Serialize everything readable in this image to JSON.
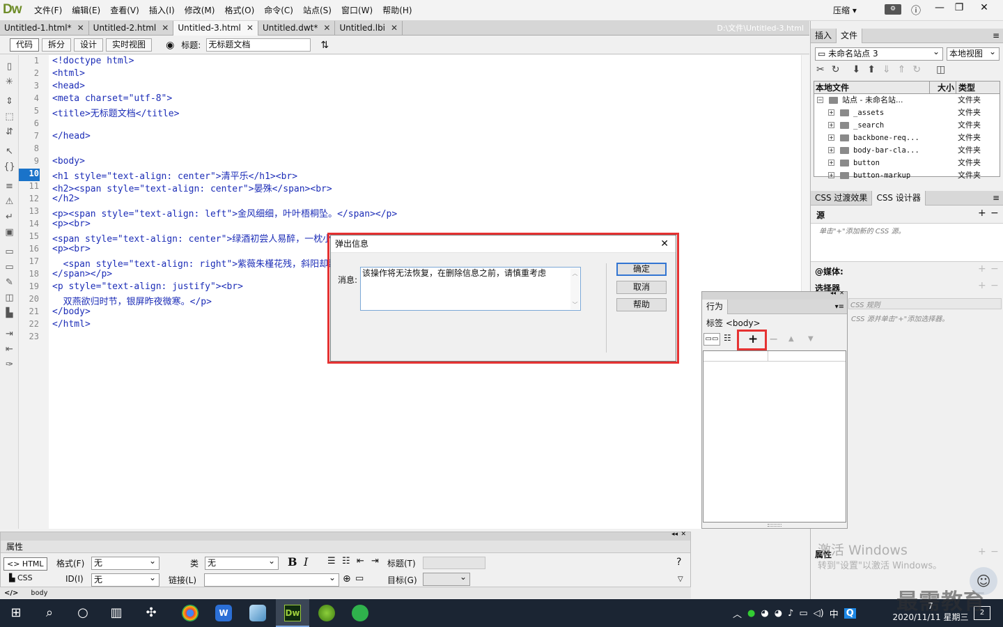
{
  "app": {
    "logo": "Dw",
    "menus": [
      "文件(F)",
      "编辑(E)",
      "查看(V)",
      "插入(I)",
      "修改(M)",
      "格式(O)",
      "命令(C)",
      "站点(S)",
      "窗口(W)",
      "帮助(H)"
    ],
    "compress": "压缩 ▾"
  },
  "tabs": [
    {
      "label": "Untitled-1.html*"
    },
    {
      "label": "Untitled-2.html"
    },
    {
      "label": "Untitled-3.html"
    },
    {
      "label": "Untitled.dwt*"
    },
    {
      "label": "Untitled.lbi"
    }
  ],
  "filepath": "D:\\文件\\Untitled-3.html",
  "doc_toolbar": {
    "views": [
      "代码",
      "拆分",
      "设计",
      "实时视图"
    ],
    "title_label": "标题:",
    "title_value": "无标题文档"
  },
  "code_lines": [
    "<!doctype html>",
    "<html>",
    "<head>",
    "<meta charset=\"utf-8\">",
    "<title>无标题文档</title>",
    "",
    "</head>",
    "",
    "<body>",
    "<h1 style=\"text-align: center\">清平乐</h1><br>",
    "<h2><span style=\"text-align: center\">晏殊</span><br>",
    "</h2>",
    "<p><span style=\"text-align: left\">金风细细，叶叶梧桐坠。</span></p>",
    "<p><br>",
    "<span style=\"text-align: center\">绿酒初尝人易醉，一枕小窗浓睡。",
    "<p><br>",
    "  <span style=\"text-align: right\">紫薇朱槿花残，斜阳却照阑干。",
    "</span></p>",
    "<p style=\"text-align: justify\"><br>",
    "  双燕欲归时节，银屏昨夜微寒。</p>",
    "</body>",
    "</html>",
    ""
  ],
  "line_numbers": [
    "1",
    "2",
    "3",
    "4",
    "5",
    "6",
    "7",
    "8",
    "9",
    "10",
    "11",
    "12",
    "13",
    "14",
    "15",
    "16",
    "17",
    "18",
    "19",
    "20",
    "21",
    "22",
    "23"
  ],
  "dialog": {
    "title": "弹出信息",
    "close": "✕",
    "message_label": "消息:",
    "message": "该操作将无法恢复，在删除信息之前，请慎重考虑",
    "buttons": {
      "ok": "确定",
      "cancel": "取消",
      "help": "帮助"
    }
  },
  "behaviors": {
    "title": "行为",
    "tag_label": "标签 <body>",
    "add": "+",
    "remove": "−"
  },
  "properties": {
    "title": "属性",
    "html_btn": "<> HTML",
    "css_btn": "CSS",
    "format_label": "格式(F)",
    "format_value": "无",
    "class_label": "类",
    "class_value": "无",
    "id_label": "ID(I)",
    "id_value": "无",
    "link_label": "链接(L)",
    "title_label": "标题(T)",
    "target_label": "目标(G)",
    "bold": "B",
    "italic": "I"
  },
  "tagbar": {
    "tag": "body"
  },
  "right_panel": {
    "tabs": [
      "插入",
      "文件"
    ],
    "site": "未命名站点 3",
    "view": "本地视图",
    "col_local": "本地文件",
    "col_size": "大小",
    "col_type": "类型",
    "root": "站点 - 未命名站...",
    "root_type": "文件夹",
    "items": [
      {
        "name": "_assets",
        "type": "文件夹"
      },
      {
        "name": "_search",
        "type": "文件夹"
      },
      {
        "name": "backbone-req...",
        "type": "文件夹"
      },
      {
        "name": "body-bar-cla...",
        "type": "文件夹"
      },
      {
        "name": "button",
        "type": "文件夹"
      },
      {
        "name": "button-markup",
        "type": "文件夹"
      }
    ],
    "css_tabs": [
      "CSS 过渡效果",
      "CSS 设计器"
    ],
    "source_label": "源",
    "source_hint": "单击\"+\"添加新的 CSS 源。",
    "media_label": "@媒体:",
    "selector_label": "选择器",
    "rules_hint": "CSS 规则",
    "rules_hint2": "CSS 源并单击\"+\"添加选择器。",
    "props_label": "属性"
  },
  "watermark": {
    "line1": "激活 Windows",
    "line2": "转到\"设置\"以激活 Windows。"
  },
  "brand": "最需教育",
  "taskbar": {
    "time": "7",
    "date": "2020/11/11 星期三",
    "ime": "中",
    "badge": "2"
  }
}
